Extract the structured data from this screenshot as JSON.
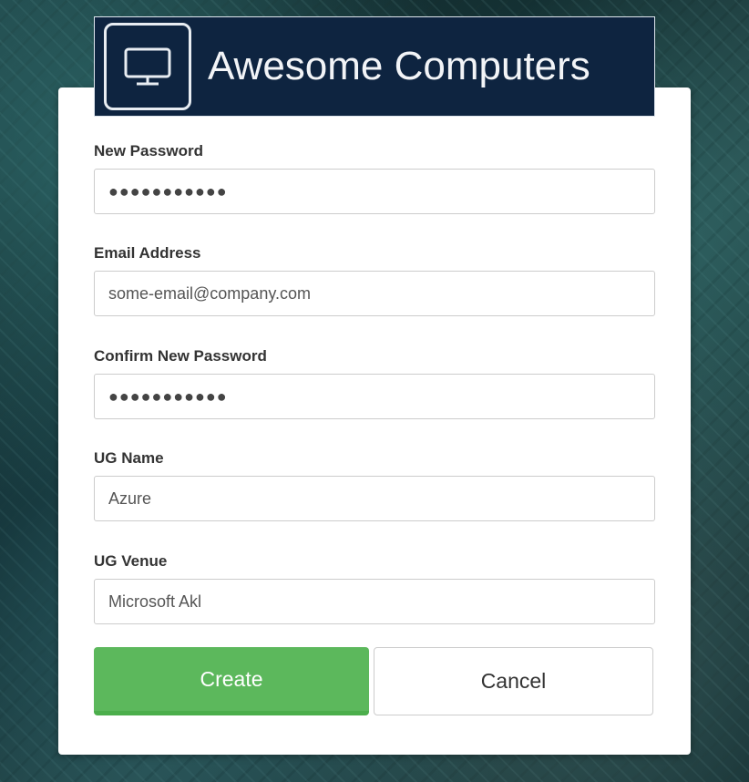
{
  "brand": {
    "name": "Awesome Computers",
    "logo_icon": "monitor-icon",
    "logo_bg_color": "#0e2440"
  },
  "form": {
    "new_password": {
      "label": "New Password",
      "value": "●●●●●●●●●●●"
    },
    "email": {
      "label": "Email Address",
      "value": "some-email@company.com"
    },
    "confirm_password": {
      "label": "Confirm New Password",
      "value": "●●●●●●●●●●●"
    },
    "ug_name": {
      "label": "UG Name",
      "value": "Azure"
    },
    "ug_venue": {
      "label": "UG Venue",
      "value": "Microsoft Akl"
    }
  },
  "actions": {
    "create_label": "Create",
    "cancel_label": "Cancel",
    "create_color": "#5cb85c"
  }
}
